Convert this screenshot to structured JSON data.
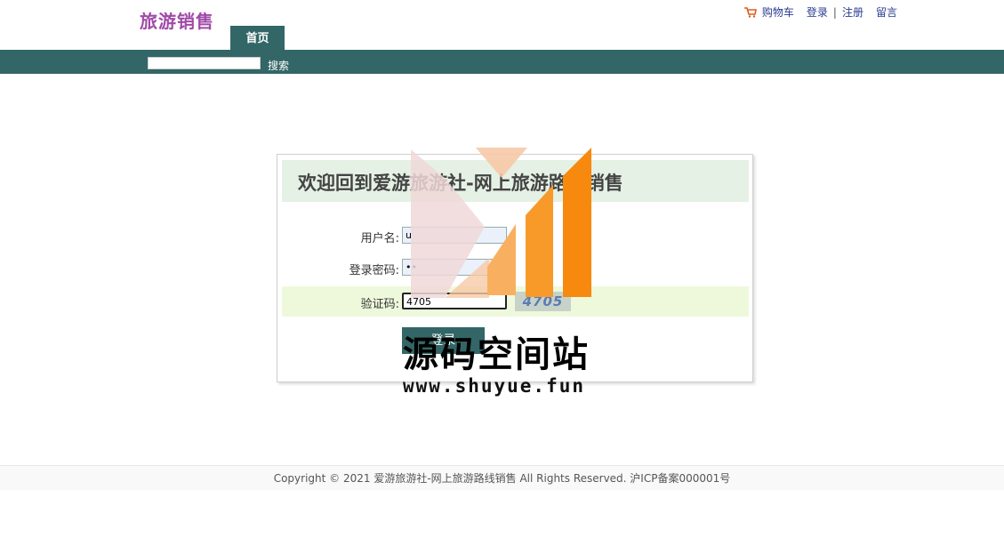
{
  "header": {
    "logo": "旅游销售",
    "links": {
      "cart": "购物车",
      "login": "登录",
      "separator": "|",
      "register": "注册",
      "message": "留言"
    },
    "cart_icon": "cart-icon"
  },
  "nav": {
    "home_tab": "首页",
    "search": {
      "value": "",
      "button_label": "搜索"
    }
  },
  "login": {
    "title": "欢迎回到爱游旅游社-网上旅游路线销售",
    "username_label": "用户名:",
    "username_value": "u",
    "password_label": "登录密码:",
    "password_value": "••",
    "captcha_label": "验证码:",
    "captcha_value": "4705",
    "captcha_image_text": "4705",
    "submit_label": "登录"
  },
  "watermark": {
    "text": "源码空间站",
    "url": "www.shuyue.fun"
  },
  "footer": {
    "copyright": "Copyright © 2021 爱游旅游社-网上旅游路线销售 All Rights Reserved. 沪ICP备案000001号"
  },
  "colors": {
    "brand": "#336666",
    "logo": "#a14aa8",
    "link": "#2a3b8f",
    "title_bg": "#e5f1e5",
    "highlight_row": "#eef9dc"
  }
}
